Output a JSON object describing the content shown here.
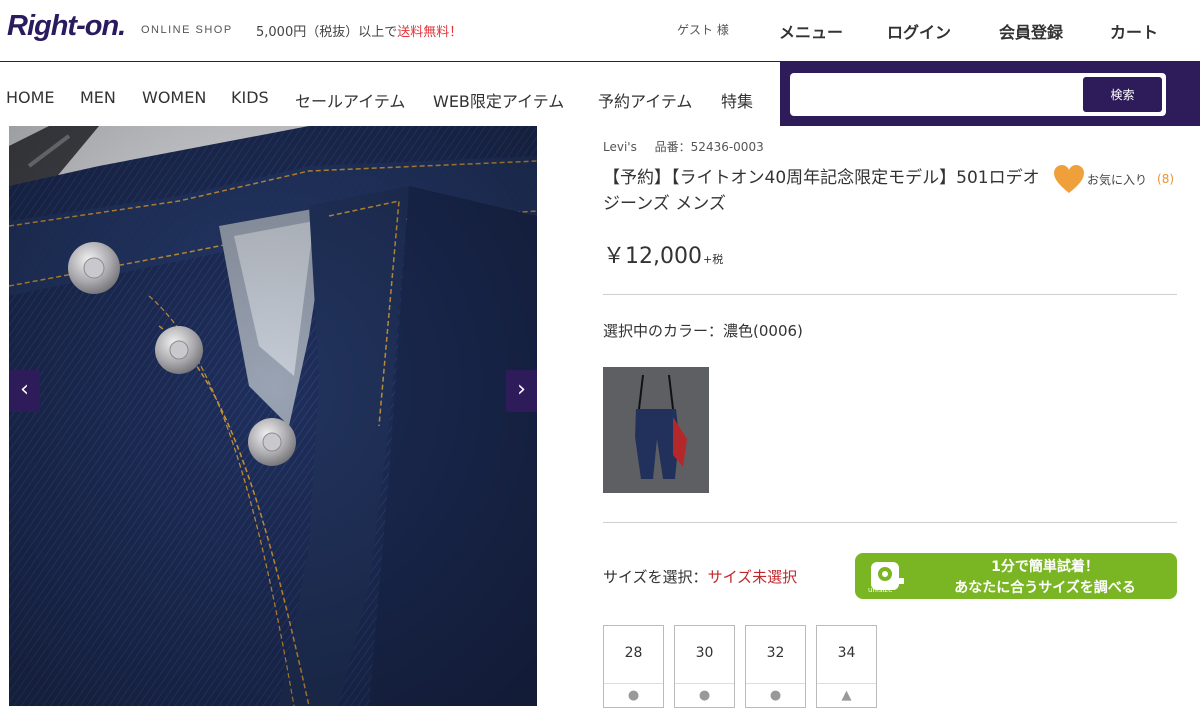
{
  "header": {
    "logo": "Right-on.",
    "logo_sub": "ONLINE SHOP",
    "shipping_prefix": "5,000円（税抜）以上で",
    "shipping_free": "送料無料！",
    "guest": "ゲスト 様",
    "menu": "メニュー",
    "login": "ログイン",
    "register": "会員登録",
    "cart": "カート"
  },
  "categories": [
    "HOME",
    "MEN",
    "WOMEN",
    "KIDS",
    "セールアイテム",
    "WEB限定アイテム",
    "予約アイテム",
    "特集"
  ],
  "search": {
    "placeholder": "",
    "button": "検索"
  },
  "product": {
    "brand": "Levi's",
    "code_label": "品番：52436-0003",
    "title": "【予約】【ライトオン40周年記念限定モデル】501ロデオジーンズ メンズ",
    "fav_label": "お気に入り",
    "fav_count": "(8)",
    "price": "￥12,000",
    "tax": "+税",
    "color_label": "選択中のカラー：",
    "color_value": "濃色(0006)",
    "size_label": "サイズを選択：",
    "size_value": "サイズ未選択",
    "unisize_line1": "1分で簡単試着！",
    "unisize_line2": "あなたに合うサイズを調べる",
    "unisize_icon_text": "unisize",
    "sizes": [
      {
        "label": "28",
        "stock": "●"
      },
      {
        "label": "30",
        "stock": "●"
      },
      {
        "label": "32",
        "stock": "●"
      },
      {
        "label": "34",
        "stock": "▲"
      }
    ]
  },
  "arrows": {
    "prev": "‹",
    "next": "›"
  },
  "colors": {
    "brand_purple": "#2d1b5a",
    "accent_green": "#7ab623",
    "fav_orange": "#f0a03b",
    "alert_red": "#c0282d"
  }
}
